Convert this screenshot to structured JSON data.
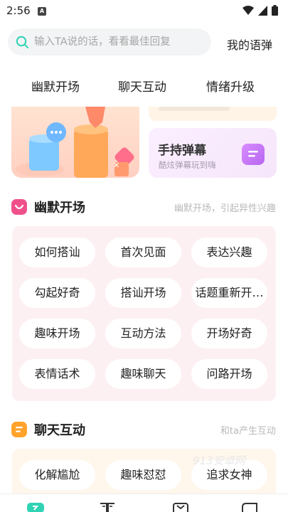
{
  "status_bar": {
    "time": "2:56",
    "notif_badge": "A"
  },
  "search": {
    "placeholder": "输入TA说的话，看看最佳回复",
    "my_bullet_label": "我的语弹"
  },
  "tabs": [
    "幽默开场",
    "聊天互动",
    "情绪升级"
  ],
  "banner": {
    "card_title": "手持弹幕",
    "card_subtitle": "酷炫弹幕玩到嗨"
  },
  "sections": [
    {
      "title": "幽默开场",
      "subtitle": "幽默开场，引起异性兴趣",
      "icon": "smile-icon",
      "icon_color": "#f0508a",
      "panel_color": "#fdf0f3",
      "tags": [
        "如何搭讪",
        "首次见面",
        "表达兴趣",
        "勾起好奇",
        "搭讪开场",
        "话题重新开…",
        "趣味开场",
        "互动方法",
        "开场好奇",
        "表情话术",
        "趣味聊天",
        "问路开场"
      ]
    },
    {
      "title": "聊天互动",
      "subtitle": "和ta产生互动",
      "icon": "chat-lines-icon",
      "icon_color": "#ffa32b",
      "panel_color": "#fff6ec",
      "tags": [
        "化解尴尬",
        "趣味怼怼",
        "追求女神"
      ]
    }
  ],
  "watermark": "913安卓网",
  "colors": {
    "accent": "#2fd3b4",
    "card_purple": "#c07af2"
  }
}
